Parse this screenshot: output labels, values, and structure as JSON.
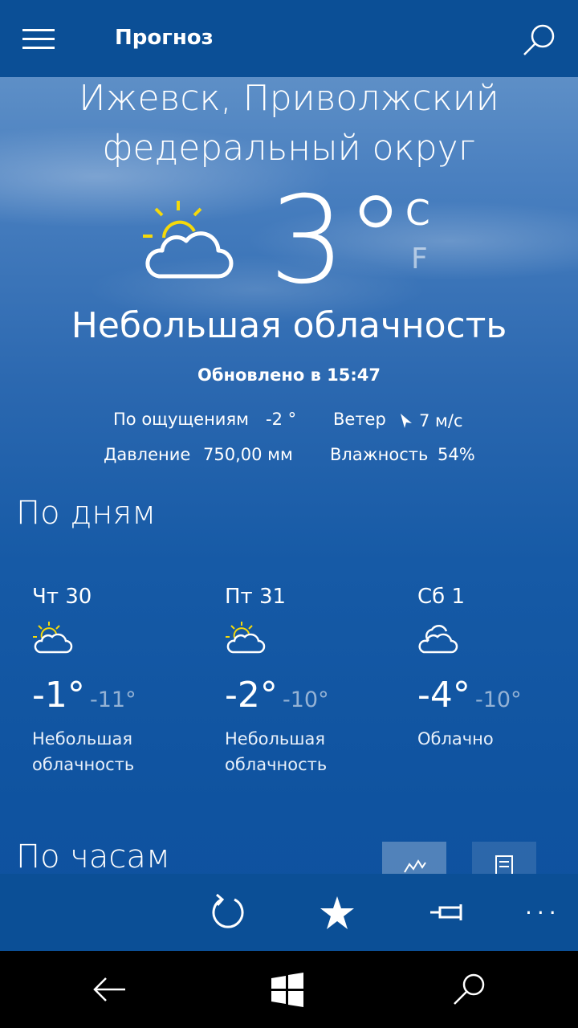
{
  "app": {
    "title": "Прогноз"
  },
  "location": {
    "line1": "Ижевск, Приволжский",
    "line2": "федеральный округ"
  },
  "current": {
    "temp": "3°",
    "unit_c": "C",
    "unit_f": "F",
    "condition": "Небольшая облачность",
    "updated": "Обновлено в 15:47",
    "icon": "partly-sunny-icon"
  },
  "details": {
    "feels_label": "По ощущениям",
    "feels_value": "-2 °",
    "wind_label": "Ветер",
    "wind_value": "7 м/с",
    "pressure_label": "Давление",
    "pressure_value": "750,00 мм",
    "humidity_label": "Влажность",
    "humidity_value": "54%"
  },
  "daily": {
    "title": "По дням",
    "days": [
      {
        "name": "Чт 30",
        "hi": "-1°",
        "lo": "-11°",
        "desc1": "Небольшая",
        "desc2": "облачность",
        "icon": "partly-sunny-icon"
      },
      {
        "name": "Пт 31",
        "hi": "-2°",
        "lo": "-10°",
        "desc1": "Небольшая",
        "desc2": "облачность",
        "icon": "partly-sunny-icon"
      },
      {
        "name": "Сб 1",
        "hi": "-4°",
        "lo": "-10°",
        "desc1": "Облачно",
        "desc2": "",
        "icon": "cloudy-icon"
      }
    ]
  },
  "hourly": {
    "title": "По часам"
  },
  "colors": {
    "bar": "#0b4f96",
    "sun": "#f5d90a",
    "accent": "#ffffff"
  }
}
